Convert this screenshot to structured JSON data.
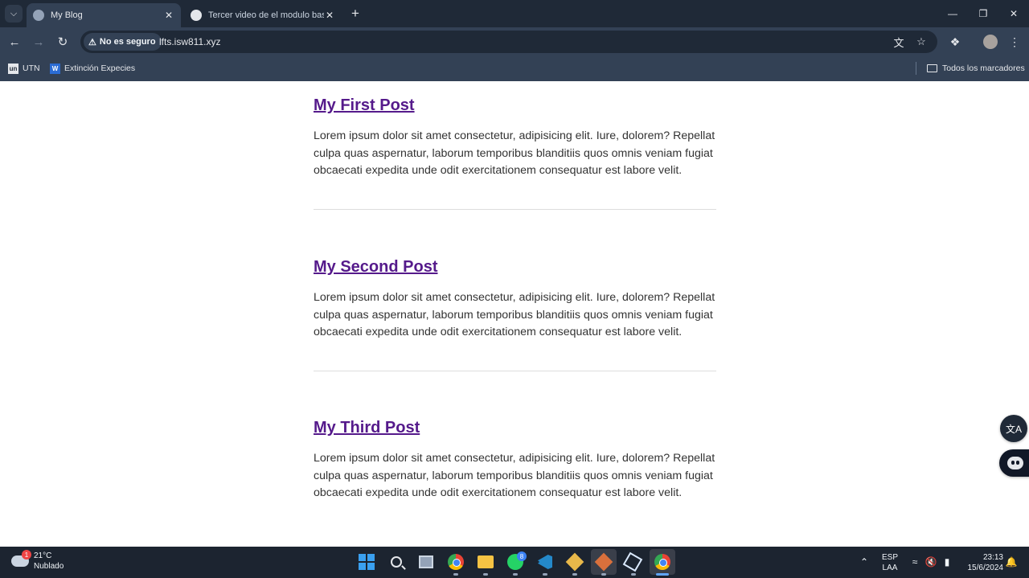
{
  "browser": {
    "tabs": [
      {
        "title": "My Blog",
        "active": true
      },
      {
        "title": "Tercer video de el modulo basic",
        "active": false
      }
    ],
    "security_label": "No es seguro",
    "url": "lfts.isw811.xyz",
    "bookmarks": [
      {
        "label": "UTN",
        "icon": "utn-icon"
      },
      {
        "label": "Extinción Expecies",
        "icon": "word-icon"
      }
    ],
    "all_bookmarks_label": "Todos los marcadores",
    "accent_color": "#334155"
  },
  "blog": {
    "link_color": "#551a8b",
    "posts": [
      {
        "title": "My First Post",
        "body": "Lorem ipsum dolor sit amet consectetur, adipisicing elit. Iure, dolorem? Repellat culpa quas aspernatur, laborum temporibus blanditiis quos omnis veniam fugiat obcaecati expedita unde odit exercitationem consequatur est labore velit."
      },
      {
        "title": "My Second Post",
        "body": "Lorem ipsum dolor sit amet consectetur, adipisicing elit. Iure, dolorem? Repellat culpa quas aspernatur, laborum temporibus blanditiis quos omnis veniam fugiat obcaecati expedita unde odit exercitationem consequatur est labore velit."
      },
      {
        "title": "My Third Post",
        "body": "Lorem ipsum dolor sit amet consectetur, adipisicing elit. Iure, dolorem? Repellat culpa quas aspernatur, laborum temporibus blanditiis quos omnis veniam fugiat obcaecati expedita unde odit exercitationem consequatur est labore velit."
      }
    ]
  },
  "taskbar": {
    "weather": {
      "temp": "21°C",
      "condition": "Nublado",
      "badge": "1"
    },
    "whatsapp_badge": "8",
    "language": {
      "line1": "ESP",
      "line2": "LAA"
    },
    "clock": {
      "time": "23:13",
      "date": "15/6/2024"
    }
  }
}
